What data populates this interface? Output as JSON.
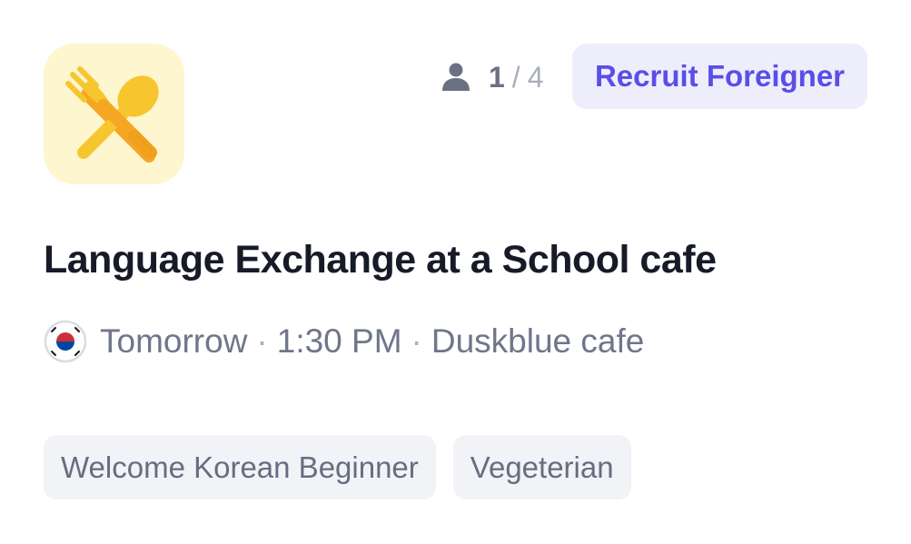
{
  "card": {
    "category_icon": "fork-spoon-icon",
    "participants": {
      "icon": "person-icon",
      "current": "1",
      "separator": "/",
      "max": "4"
    },
    "recruit_label": "Recruit Foreigner",
    "title": "Language Exchange at a School cafe",
    "meta": {
      "flag_icon": "korea-flag-icon",
      "day": "Tomorrow",
      "separator": "·",
      "time": "1:30 PM",
      "place": "Duskblue cafe"
    },
    "tags": [
      "Welcome Korean Beginner",
      "Vegeterian"
    ]
  },
  "colors": {
    "icon_bg": "#FEF6CF",
    "accent": "#5A4EE8",
    "badge_bg": "#EEEDFC",
    "title": "#171B28",
    "muted": "#70768A",
    "tag_bg": "#F1F3F7"
  }
}
